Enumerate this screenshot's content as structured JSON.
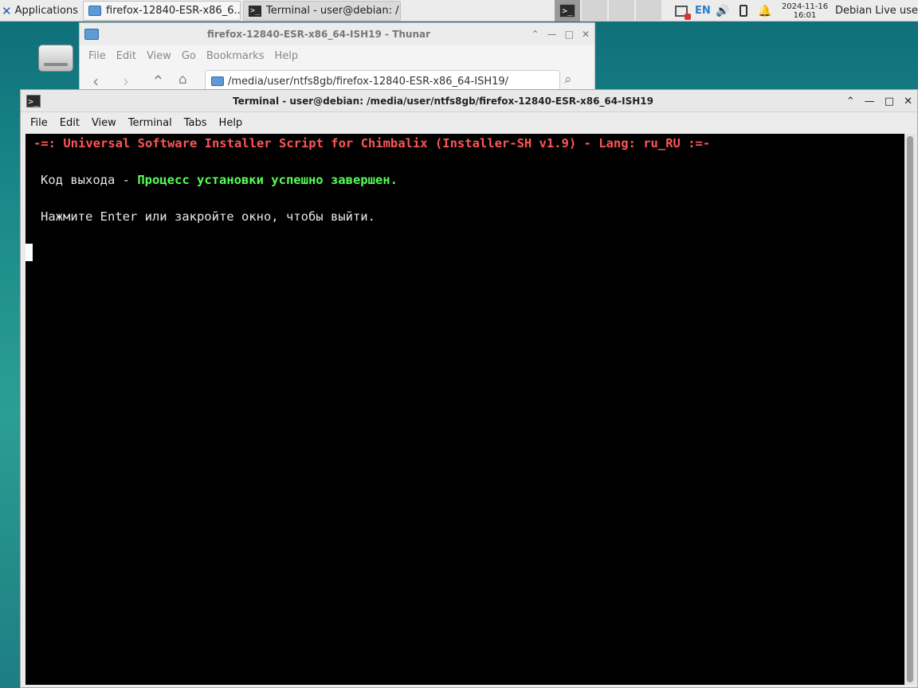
{
  "panel": {
    "applications_label": "Applications",
    "tasks": [
      {
        "label": "firefox-12840-ESR-x86_6..."
      },
      {
        "label": "Terminal - user@debian: /..."
      }
    ],
    "language": "EN",
    "clock_date": "2024-11-16",
    "clock_time": "16:01",
    "user": "Debian Live user"
  },
  "thunar": {
    "title": "firefox-12840-ESR-x86_64-ISH19 - Thunar",
    "menu": [
      "File",
      "Edit",
      "View",
      "Go",
      "Bookmarks",
      "Help"
    ],
    "location": "/media/user/ntfs8gb/firefox-12840-ESR-x86_64-ISH19/"
  },
  "terminal": {
    "title": "Terminal - user@debian: /media/user/ntfs8gb/firefox-12840-ESR-x86_64-ISH19",
    "menu": [
      "File",
      "Edit",
      "View",
      "Terminal",
      "Tabs",
      "Help"
    ],
    "header_line": "-=: Universal Software Installer Script for Chimbalix (Installer-SH v1.9) - Lang: ru_RU :=-",
    "exit_label": "Код выхода - ",
    "exit_status": "Процесс установки успешно завершен.",
    "prompt_line": "Нажмите Enter или закройте окно, чтобы выйти."
  },
  "colors": {
    "header_red": "#ff5555",
    "success_green": "#55ff55",
    "terminal_bg": "#000000",
    "desktop_teal": "#1a8a8a"
  }
}
